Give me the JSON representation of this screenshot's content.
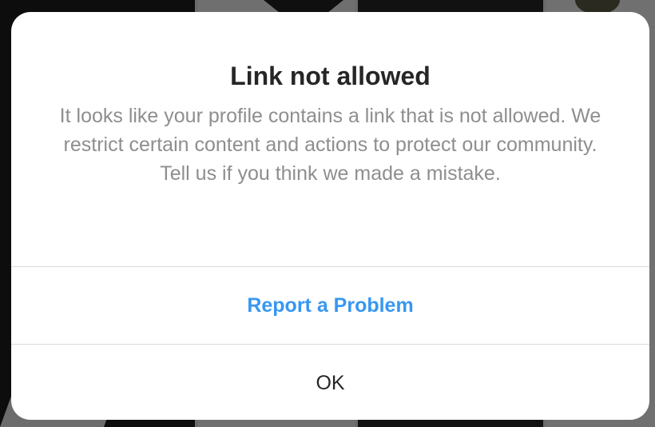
{
  "dialog": {
    "title": "Link not allowed",
    "message": "It looks like your profile contains a link that is not allowed. We restrict certain content and actions to protect our community. Tell us if you think we made a mistake.",
    "actions": {
      "report_label": "Report a Problem",
      "ok_label": "OK"
    }
  },
  "colors": {
    "title": "#262626",
    "message": "#8e8e8e",
    "link_action": "#3897f0",
    "divider": "#dbdbdb"
  }
}
